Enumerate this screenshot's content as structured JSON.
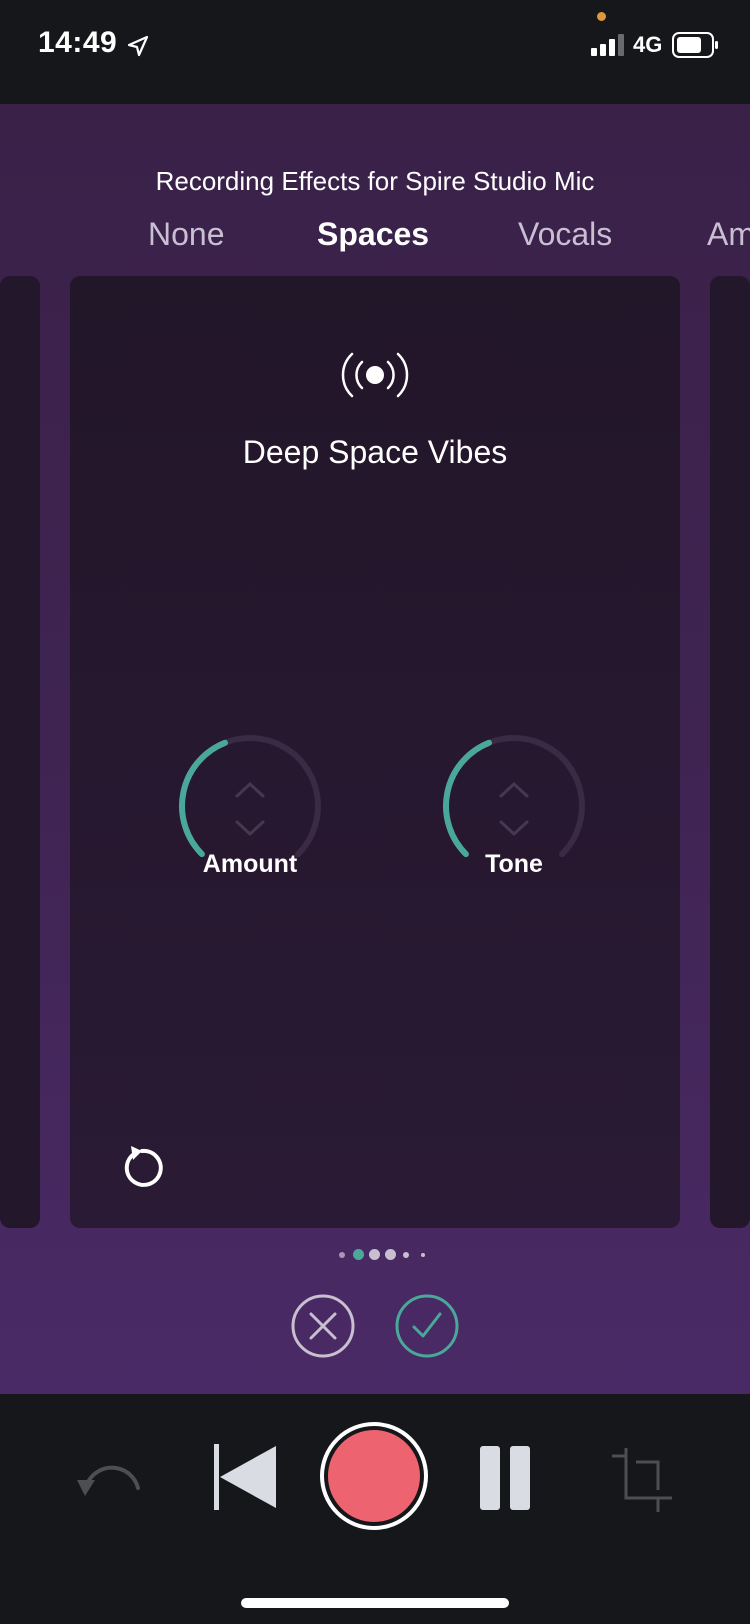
{
  "status_bar": {
    "time": "14:49",
    "network": "4G",
    "icons": [
      "location-arrow-icon",
      "signal-bars-icon",
      "battery-icon"
    ],
    "recording_indicator_color": "#e0963a"
  },
  "effects_panel": {
    "title": "Recording Effects for Spire Studio Mic",
    "tabs": [
      {
        "label": "None",
        "active": false
      },
      {
        "label": "Spaces",
        "active": true
      },
      {
        "label": "Vocals",
        "active": false
      },
      {
        "label": "Am",
        "active": false
      }
    ],
    "card": {
      "icon": "broadcast-icon",
      "title": "Deep Space Vibes",
      "knobs": [
        {
          "label": "Amount",
          "value_fraction": 0.42
        },
        {
          "label": "Tone",
          "value_fraction": 0.42
        }
      ],
      "reset_icon": "reset-icon"
    },
    "page_dots": {
      "count": 6,
      "active_index": 1
    },
    "cancel_icon": "close-circle-icon",
    "confirm_icon": "check-circle-icon"
  },
  "transport": {
    "buttons": [
      "undo-icon",
      "rewind-icon",
      "record-button",
      "pause-icon",
      "crop-icon"
    ],
    "record_color": "#ed6470"
  },
  "colors": {
    "accent": "#4aa89a",
    "panel_bg": "#3f2452",
    "card_bg": "#241729",
    "bar_bg": "#16171a"
  }
}
